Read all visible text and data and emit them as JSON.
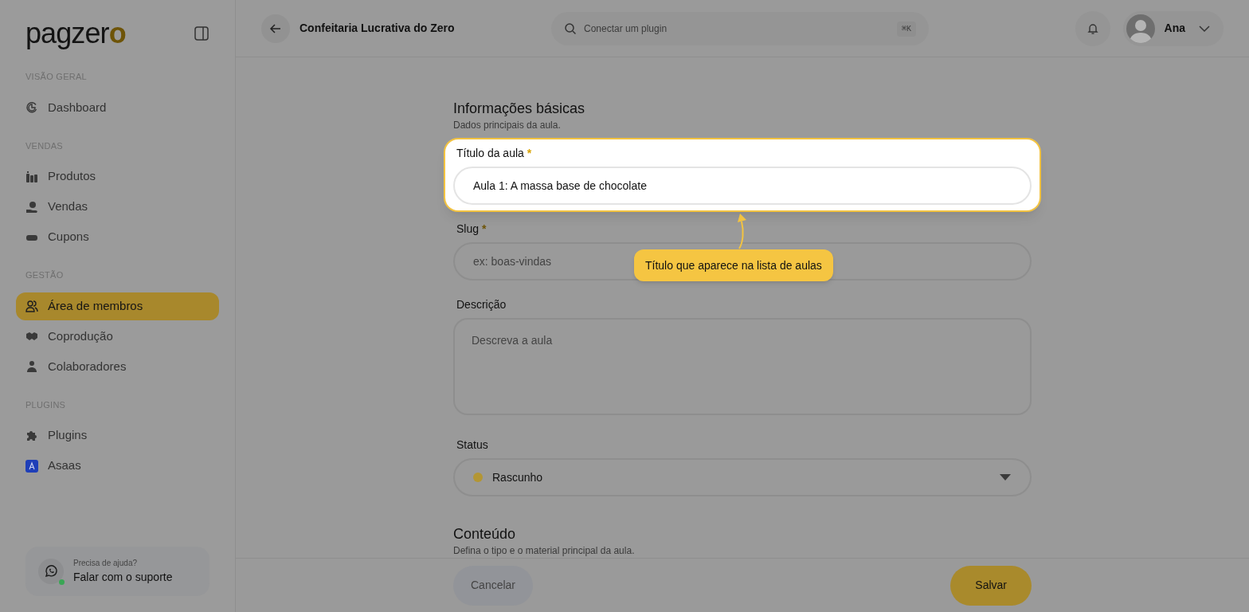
{
  "sidebar": {
    "logo": {
      "text": "pagzer",
      "accent": "o"
    },
    "sections": [
      {
        "title": "VISÃO GERAL",
        "items": [
          {
            "label": "Dashboard",
            "selected": false
          }
        ]
      },
      {
        "title": "VENDAS",
        "items": [
          {
            "label": "Produtos",
            "selected": false
          },
          {
            "label": "Vendas",
            "selected": false
          },
          {
            "label": "Cupons",
            "selected": false
          }
        ]
      },
      {
        "title": "GESTÃO",
        "items": [
          {
            "label": "Área de membros",
            "selected": true
          },
          {
            "label": "Coprodução",
            "selected": false
          },
          {
            "label": "Colaboradores",
            "selected": false
          }
        ]
      },
      {
        "title": "PLUGINS",
        "items": [
          {
            "label": "Plugins",
            "selected": false
          },
          {
            "label": "Asaas",
            "selected": false
          }
        ]
      }
    ],
    "support": {
      "caption": "Precisa de ajuda?",
      "label": "Falar com o suporte",
      "online": true
    }
  },
  "header": {
    "title": "Confeitaria Lucrativa do Zero",
    "search": {
      "placeholder": "Conectar um plugin",
      "shortcut": "⌘K"
    },
    "user": {
      "name": "Ana"
    }
  },
  "form": {
    "sections": [
      {
        "title": "Informações básicas",
        "subtitle": "Dados principais da aula.",
        "fields": [
          {
            "kind": "text",
            "label": "Título da aula",
            "required_mark": "*",
            "highlighted": true,
            "value": "Aula 1: A massa base de chocolate"
          },
          {
            "kind": "text",
            "label": "Slug",
            "required_mark": "*",
            "placeholder": "ex: boas-vindas"
          },
          {
            "kind": "textarea",
            "label": "Descrição",
            "placeholder": "Descreva a aula"
          },
          {
            "kind": "select",
            "label": "Status",
            "value": "Rascunho",
            "color": "#b39634"
          }
        ]
      },
      {
        "title": "Conteúdo",
        "subtitle": "Defina o tipo e o material principal da aula."
      }
    ]
  },
  "tour": {
    "text": "Título que aparece na lista de aulas"
  },
  "footer": {
    "cancel": "Cancelar",
    "save": "Salvar"
  }
}
